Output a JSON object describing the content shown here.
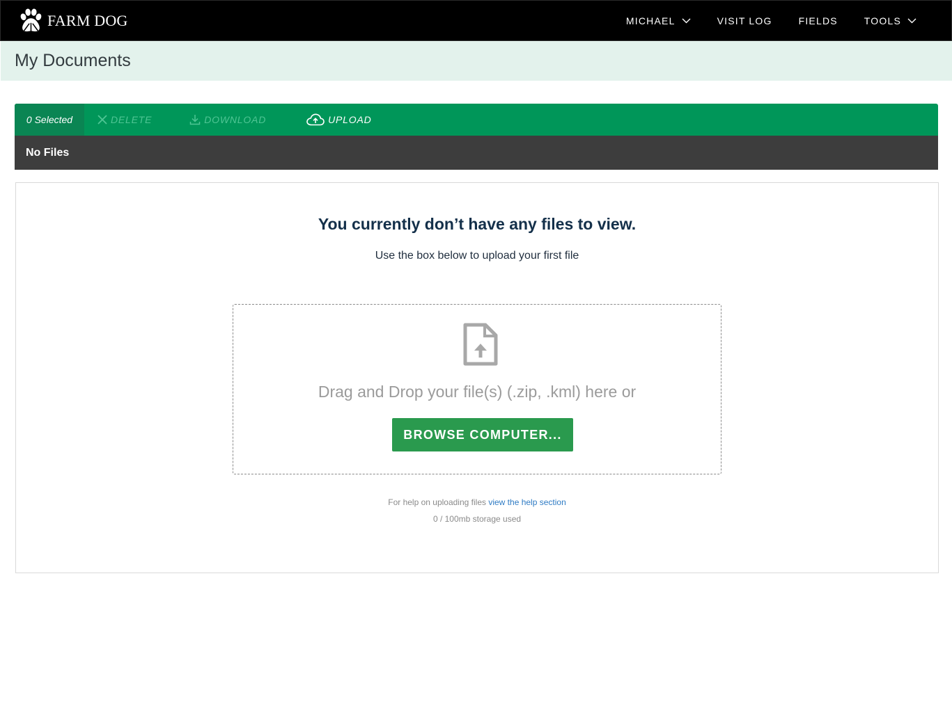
{
  "brand": {
    "name": "FARM DOG",
    "logo_icon": "paw-icon"
  },
  "nav": {
    "items": [
      {
        "label": "MICHAEL",
        "dropdown": true
      },
      {
        "label": "VISIT LOG",
        "dropdown": false
      },
      {
        "label": "FIELDS",
        "dropdown": false
      },
      {
        "label": "TOOLS",
        "dropdown": true
      }
    ]
  },
  "page": {
    "title": "My Documents"
  },
  "toolbar": {
    "selected_label": "0 Selected",
    "delete_label": "DELETE",
    "download_label": "DOWNLOAD",
    "upload_label": "UPLOAD"
  },
  "file_list": {
    "status": "No Files"
  },
  "empty_state": {
    "title": "You currently don’t have any files to view.",
    "subtitle": "Use the box below to upload your first file"
  },
  "dropzone": {
    "text": "Drag and Drop your file(s) (.zip, .kml) here or",
    "browse_label": "BROWSE COMPUTER...",
    "icon": "file-upload-icon"
  },
  "help": {
    "prefix": "For help on uploading files",
    "link_text": "view the help section",
    "storage": "0 / 100mb storage used"
  },
  "colors": {
    "nav_bg": "#000000",
    "header_bg": "#e3f2ec",
    "toolbar_green": "#009659",
    "browse_green": "#2a9a4e",
    "no_files_bar": "#3d3d3d",
    "link_blue": "#2e7bc4"
  }
}
